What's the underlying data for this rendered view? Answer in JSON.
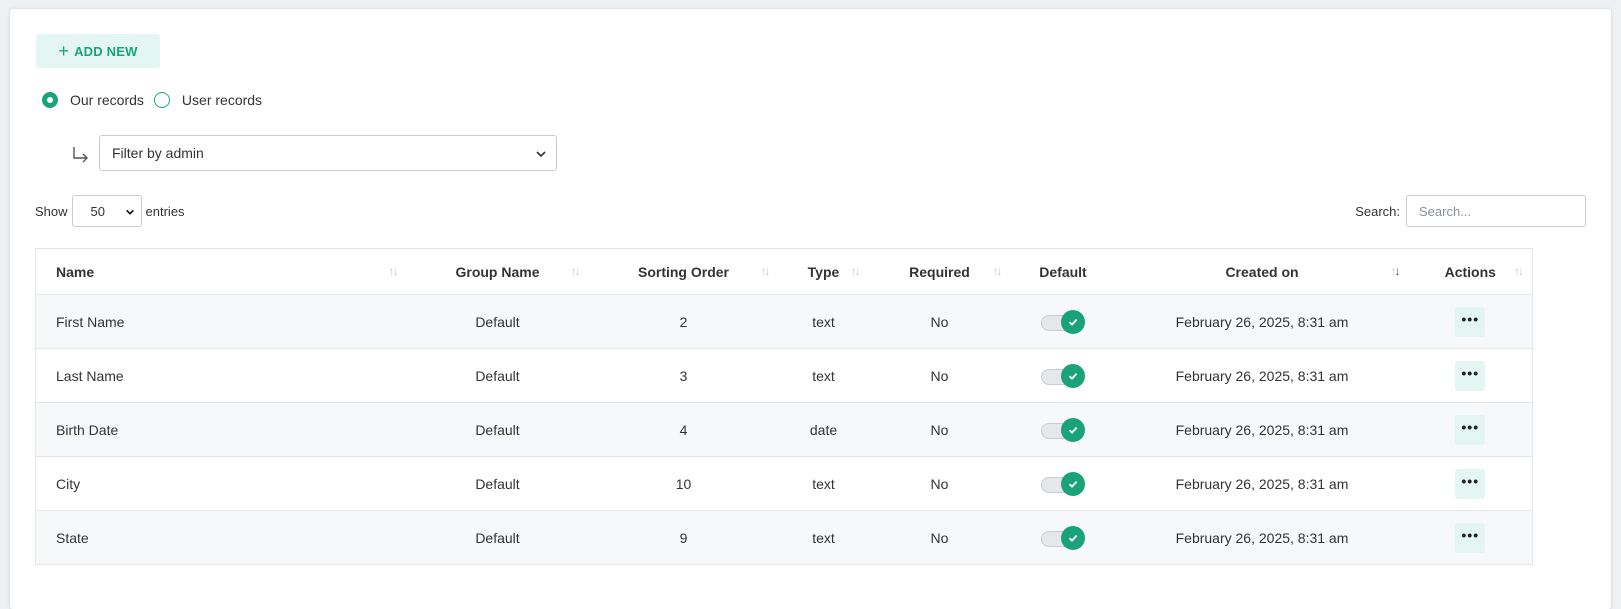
{
  "toolbar": {
    "add_new_label": "ADD NEW"
  },
  "records_filter": {
    "options": [
      {
        "label": "Our records",
        "checked": true
      },
      {
        "label": "User records",
        "checked": false
      }
    ]
  },
  "admin_filter": {
    "selected": "Filter by admin"
  },
  "entries": {
    "show_label": "Show",
    "value": "50",
    "suffix_label": "entries"
  },
  "search": {
    "label": "Search:",
    "placeholder": "Search..."
  },
  "table": {
    "columns": [
      "Name",
      "Group Name",
      "Sorting Order",
      "Type",
      "Required",
      "Default",
      "Created on",
      "Actions"
    ],
    "rows": [
      {
        "name": "First Name",
        "group": "Default",
        "order": "2",
        "type": "text",
        "required": "No",
        "default": true,
        "created": "February 26, 2025, 8:31 am"
      },
      {
        "name": "Last Name",
        "group": "Default",
        "order": "3",
        "type": "text",
        "required": "No",
        "default": true,
        "created": "February 26, 2025, 8:31 am"
      },
      {
        "name": "Birth Date",
        "group": "Default",
        "order": "4",
        "type": "date",
        "required": "No",
        "default": true,
        "created": "February 26, 2025, 8:31 am"
      },
      {
        "name": "City",
        "group": "Default",
        "order": "10",
        "type": "text",
        "required": "No",
        "default": true,
        "created": "February 26, 2025, 8:31 am"
      },
      {
        "name": "State",
        "group": "Default",
        "order": "9",
        "type": "text",
        "required": "No",
        "default": true,
        "created": "February 26, 2025, 8:31 am"
      }
    ]
  },
  "colors": {
    "accent": "#1aa37a",
    "accent_light": "#e3f6f1",
    "row_alt": "#f7f8fa"
  }
}
